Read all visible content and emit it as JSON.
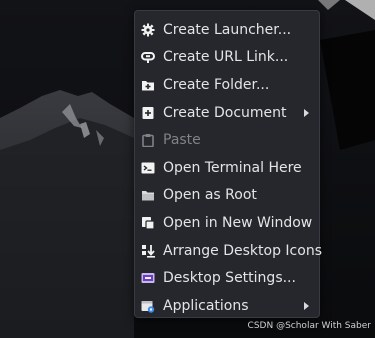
{
  "menu": {
    "items": [
      {
        "label": "Create Launcher...",
        "icon": "gear-icon",
        "enabled": true,
        "submenu": false
      },
      {
        "label": "Create URL Link...",
        "icon": "link-icon",
        "enabled": true,
        "submenu": false
      },
      {
        "label": "Create Folder...",
        "icon": "folder-plus-icon",
        "enabled": true,
        "submenu": false
      },
      {
        "label": "Create Document",
        "icon": "document-plus-icon",
        "enabled": true,
        "submenu": true
      },
      {
        "label": "Paste",
        "icon": "clipboard-icon",
        "enabled": false,
        "submenu": false
      },
      {
        "label": "Open Terminal Here",
        "icon": "terminal-icon",
        "enabled": true,
        "submenu": false
      },
      {
        "label": "Open as Root",
        "icon": "folder-icon",
        "enabled": true,
        "submenu": false
      },
      {
        "label": "Open in New Window",
        "icon": "new-window-icon",
        "enabled": true,
        "submenu": false
      },
      {
        "label": "Arrange Desktop Icons",
        "icon": "arrange-icon",
        "enabled": true,
        "submenu": false
      },
      {
        "label": "Desktop Settings...",
        "icon": "desktop-settings-icon",
        "enabled": true,
        "submenu": false
      },
      {
        "label": "Applications",
        "icon": "applications-icon",
        "enabled": true,
        "submenu": true
      }
    ]
  },
  "watermark": "CSDN @Scholar With Saber"
}
